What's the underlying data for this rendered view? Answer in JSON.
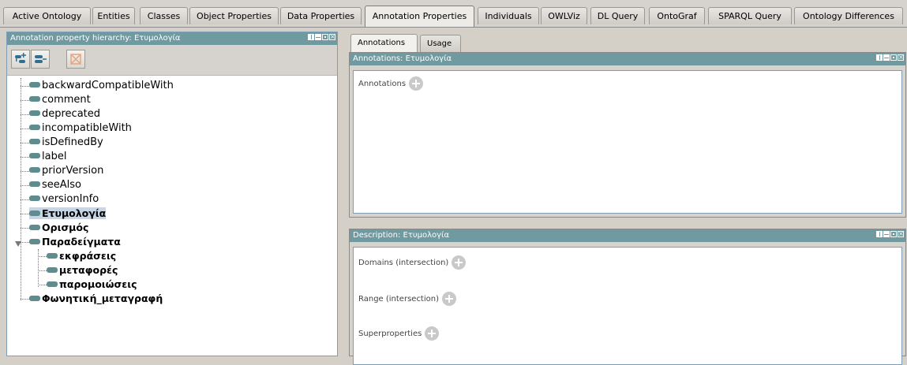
{
  "main_tabs": [
    {
      "label": "Active Ontology",
      "active": false
    },
    {
      "label": "Entities",
      "active": false
    },
    {
      "label": "Classes",
      "active": false
    },
    {
      "label": "Object Properties",
      "active": false
    },
    {
      "label": "Data Properties",
      "active": false
    },
    {
      "label": "Annotation Properties",
      "active": true
    },
    {
      "label": "Individuals",
      "active": false
    },
    {
      "label": "OWLViz",
      "active": false
    },
    {
      "label": "DL Query",
      "active": false
    },
    {
      "label": "OntoGraf",
      "active": false
    },
    {
      "label": "SPARQL Query",
      "active": false
    },
    {
      "label": "Ontology Differences",
      "active": false
    }
  ],
  "hierarchy": {
    "title": "Annotation property hierarchy: Ετυμολογία",
    "toolbar": [
      {
        "icon": "add-sub-property-icon"
      },
      {
        "icon": "add-sibling-property-icon"
      },
      {
        "icon": "delete-property-icon"
      }
    ],
    "items": [
      {
        "label": "backwardCompatibleWith",
        "bold": false,
        "selected": false
      },
      {
        "label": "comment",
        "bold": false,
        "selected": false
      },
      {
        "label": "deprecated",
        "bold": false,
        "selected": false
      },
      {
        "label": "incompatibleWith",
        "bold": false,
        "selected": false
      },
      {
        "label": "isDefinedBy",
        "bold": false,
        "selected": false
      },
      {
        "label": "label",
        "bold": false,
        "selected": false
      },
      {
        "label": "priorVersion",
        "bold": false,
        "selected": false
      },
      {
        "label": "seeAlso",
        "bold": false,
        "selected": false
      },
      {
        "label": "versionInfo",
        "bold": false,
        "selected": false
      },
      {
        "label": "Ετυμολογία",
        "bold": true,
        "selected": true
      },
      {
        "label": "Ορισμός",
        "bold": true,
        "selected": false
      },
      {
        "label": "Παραδείγματα",
        "bold": true,
        "selected": false,
        "expanded": true
      },
      {
        "label": "εκφράσεις",
        "bold": true,
        "selected": false,
        "child": true
      },
      {
        "label": "μεταφορές",
        "bold": true,
        "selected": false,
        "child": true
      },
      {
        "label": "παρομοιώσεις",
        "bold": true,
        "selected": false,
        "child": true
      },
      {
        "label": "Φωνητική_μεταγραφή",
        "bold": true,
        "selected": false
      }
    ]
  },
  "right_tabs": [
    {
      "label": "Annotations",
      "active": true
    },
    {
      "label": "Usage",
      "active": false
    }
  ],
  "annotations_view": {
    "title": "Annotations: Ετυμολογία",
    "section_label": "Annotations"
  },
  "description_view": {
    "title": "Description: Ετυμολογία",
    "sections": [
      {
        "label": "Domains (intersection)"
      },
      {
        "label": "Range (intersection)"
      },
      {
        "label": "Superproperties"
      }
    ]
  },
  "colors": {
    "view_header": "#6f9aa0",
    "property_icon": "#5f8c8f",
    "selection": "#c5d6e6"
  }
}
